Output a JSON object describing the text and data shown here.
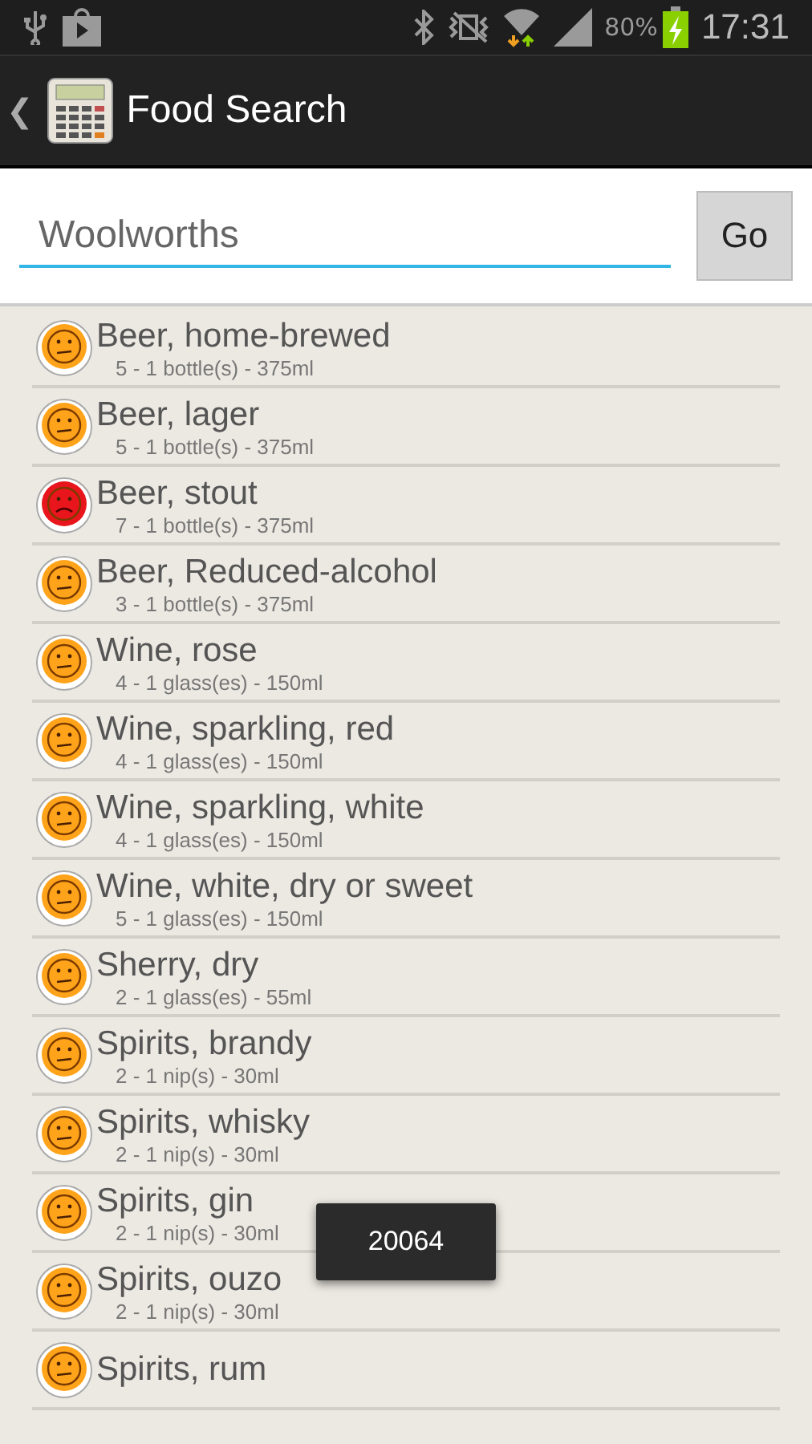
{
  "status_bar": {
    "battery": "80%",
    "time": "17:31"
  },
  "action_bar": {
    "back": "❮",
    "title": "Food Search"
  },
  "search": {
    "value": "Woolworths",
    "button": "Go"
  },
  "items": [
    {
      "name": "Beer, home-brewed",
      "detail": "5 - 1 bottle(s) - 375ml",
      "kind": "neutral"
    },
    {
      "name": "Beer, lager",
      "detail": "5 - 1 bottle(s) - 375ml",
      "kind": "neutral"
    },
    {
      "name": "Beer, stout",
      "detail": "7 - 1 bottle(s) - 375ml",
      "kind": "sad"
    },
    {
      "name": "Beer, Reduced-alcohol",
      "detail": "3 - 1 bottle(s) - 375ml",
      "kind": "neutral"
    },
    {
      "name": "Wine, rose",
      "detail": "4 - 1 glass(es) - 150ml",
      "kind": "neutral"
    },
    {
      "name": "Wine, sparkling, red",
      "detail": "4 - 1 glass(es) - 150ml",
      "kind": "neutral"
    },
    {
      "name": "Wine, sparkling, white",
      "detail": "4 - 1 glass(es) - 150ml",
      "kind": "neutral"
    },
    {
      "name": "Wine, white, dry or sweet",
      "detail": "5 - 1 glass(es) - 150ml",
      "kind": "neutral"
    },
    {
      "name": "Sherry, dry",
      "detail": "2 - 1 glass(es) - 55ml",
      "kind": "neutral"
    },
    {
      "name": "Spirits, brandy",
      "detail": "2 - 1 nip(s) - 30ml",
      "kind": "neutral"
    },
    {
      "name": "Spirits, whisky",
      "detail": "2 - 1 nip(s) - 30ml",
      "kind": "neutral"
    },
    {
      "name": "Spirits, gin",
      "detail": "2 - 1 nip(s) - 30ml",
      "kind": "neutral"
    },
    {
      "name": "Spirits, ouzo",
      "detail": "2 - 1 nip(s) - 30ml",
      "kind": "neutral"
    },
    {
      "name": "Spirits, rum",
      "kind": "neutral"
    }
  ],
  "toast": "20064"
}
